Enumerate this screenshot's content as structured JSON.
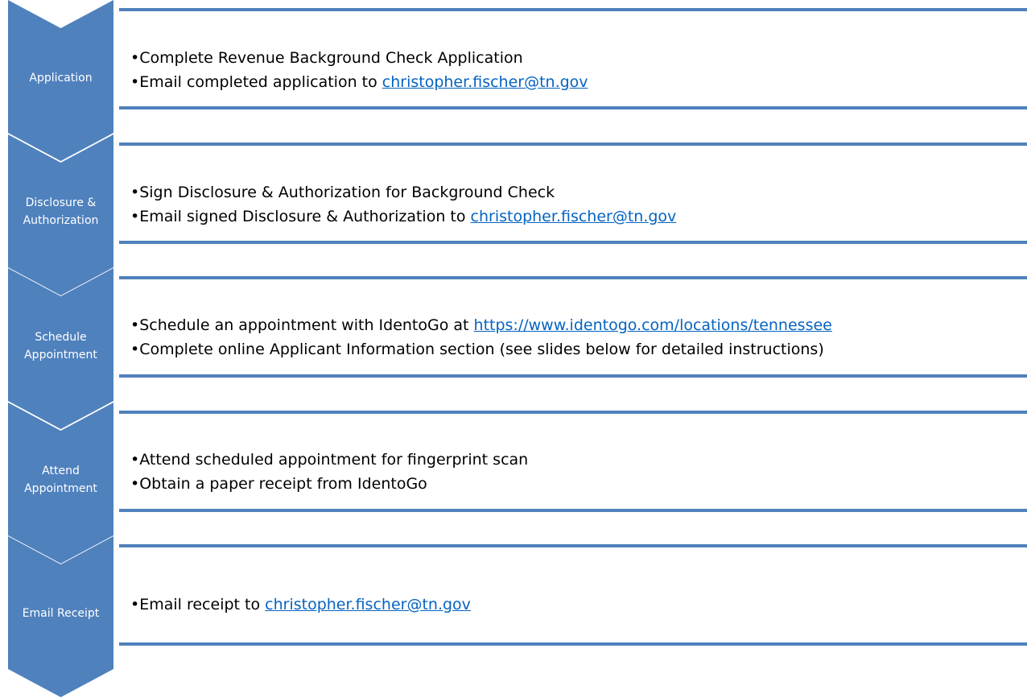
{
  "colors": {
    "chevron": "#4f81bd",
    "border": "#4f81bd",
    "link": "#0563c1",
    "text": "#000000"
  },
  "bullet": "•",
  "steps": [
    {
      "label": [
        "Application"
      ],
      "lines": [
        {
          "text": "Complete Revenue Background Check Application",
          "link": ""
        },
        {
          "text": "Email completed application to ",
          "link": "christopher.fischer@tn.gov"
        }
      ]
    },
    {
      "label": [
        "Disclosure &",
        "Authorization"
      ],
      "lines": [
        {
          "text": "Sign Disclosure & Authorization for Background Check",
          "link": ""
        },
        {
          "text": "Email signed Disclosure & Authorization to ",
          "link": "christopher.fischer@tn.gov"
        }
      ]
    },
    {
      "label": [
        "Schedule",
        "Appointment"
      ],
      "lines": [
        {
          "text": "Schedule an appointment with IdentoGo at ",
          "link": "https://www.identogo.com/locations/tennessee"
        },
        {
          "text": "Complete online Applicant Information section (see slides below for detailed instructions)",
          "link": ""
        }
      ]
    },
    {
      "label": [
        "Attend",
        "Appointment"
      ],
      "lines": [
        {
          "text": "Attend scheduled appointment for fingerprint scan",
          "link": ""
        },
        {
          "text": "Obtain a paper receipt from IdentoGo",
          "link": ""
        }
      ]
    },
    {
      "label": [
        "Email Receipt"
      ],
      "lines": [
        {
          "text": "Email receipt to ",
          "link": "christopher.fischer@tn.gov"
        }
      ]
    }
  ]
}
